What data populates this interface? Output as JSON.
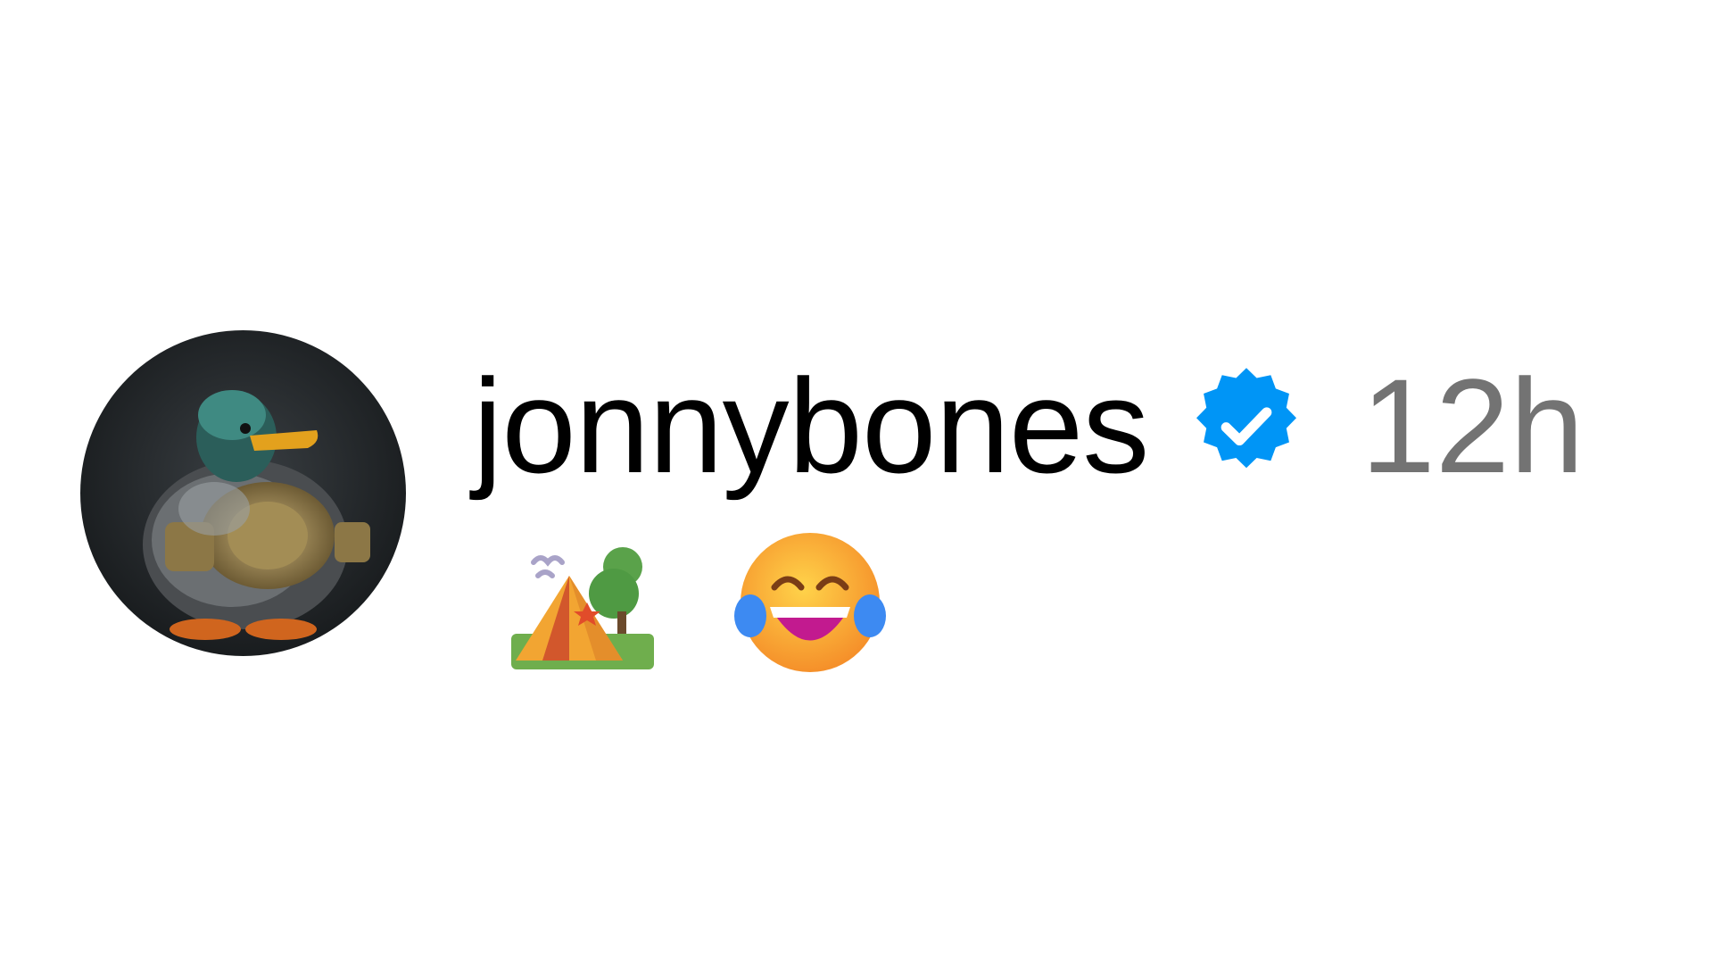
{
  "comment": {
    "author": {
      "username": "jonnybones",
      "verified": true,
      "avatar": "duck-with-championship-belt-avatar"
    },
    "timestamp": "12h",
    "emojis": [
      "camping-tent-emoji",
      "face-with-tears-of-joy-emoji"
    ]
  },
  "colors": {
    "verified_badge": "#0095F6",
    "username_text": "#000000",
    "timestamp_text": "#737373",
    "background": "#FFFFFF"
  }
}
